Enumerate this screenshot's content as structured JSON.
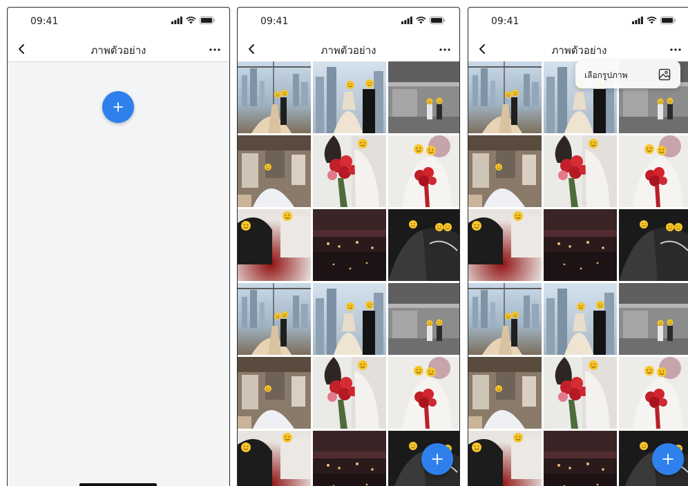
{
  "status": {
    "time": "09:41"
  },
  "nav": {
    "title": "ภาพตัวอย่าง"
  },
  "menu": {
    "choose_image": "เลือกรูปภาพ"
  },
  "icons": {
    "back": "chevron-left-icon",
    "more": "ellipsis-icon",
    "add": "plus-icon",
    "gallery": "image-icon",
    "signal": "signal-icon",
    "wifi": "wifi-icon",
    "battery": "battery-icon"
  },
  "colors": {
    "accent": "#2f80ed",
    "empty_background": "#f3f4f6",
    "text": "#1c1c1e"
  },
  "gallery": {
    "photos": [
      {
        "scene": "bride-city-window"
      },
      {
        "scene": "couple-skyline"
      },
      {
        "scene": "couple-monochrome"
      },
      {
        "scene": "bride-hall"
      },
      {
        "scene": "bouquet-closeup"
      },
      {
        "scene": "bouquet-couple"
      },
      {
        "scene": "couple-red-blur"
      },
      {
        "scene": "reception-dark"
      },
      {
        "scene": "couple-bw-dark"
      },
      {
        "scene": "bride-city-window"
      },
      {
        "scene": "couple-skyline"
      },
      {
        "scene": "couple-monochrome"
      },
      {
        "scene": "bride-hall"
      },
      {
        "scene": "bouquet-closeup"
      },
      {
        "scene": "bouquet-couple"
      },
      {
        "scene": "couple-red-blur"
      },
      {
        "scene": "reception-dark"
      },
      {
        "scene": "couple-bw-dark"
      }
    ]
  }
}
